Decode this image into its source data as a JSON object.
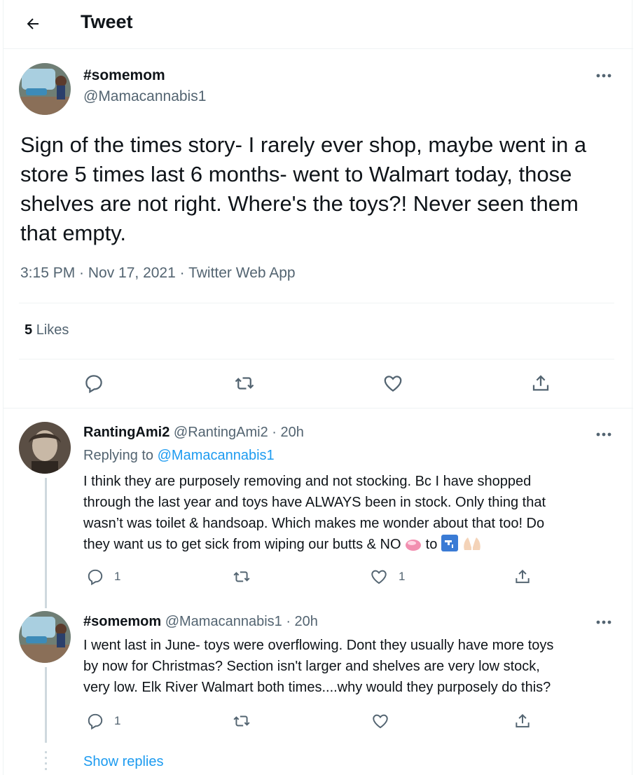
{
  "header": {
    "title": "Tweet",
    "back_icon": "arrow-left-icon"
  },
  "main_tweet": {
    "display_name": "#somemom",
    "handle": "@Mamacannabis1",
    "text": "Sign of the times story- I rarely ever shop, maybe went in a store 5 times last 6 months- went to Walmart today, those shelves are not right. Where's the toys?! Never seen them that empty.",
    "timestamp": "3:15 PM · Nov 17, 2021 · Twitter Web App",
    "likes_count": "5",
    "likes_label": "Likes"
  },
  "replies": [
    {
      "display_name": "RantingAmi2",
      "handle_time": "@RantingAmi2 · 20h",
      "replying_prefix": "Replying to",
      "replying_to": "@Mamacannabis1",
      "text_lines": [
        "I think they are purposely removing and not stocking. Bc I have shopped",
        "through the last year and toys have ALWAYS been in stock. Only thing that",
        "wasn’t was toilet & handsoap. Which makes me wonder about that too! Do",
        "they want us to get sick from wiping our butts & NO"
      ],
      "text_tail": "to",
      "reply_count": "1",
      "like_count": "1"
    },
    {
      "display_name": "#somemom",
      "handle_time": "@Mamacannabis1 · 20h",
      "text_lines": [
        "I went last in June- toys were overflowing. Dont they usually have more toys",
        "by now for Christmas? Section isn't larger and shelves are very low stock,",
        "very low. Elk River Walmart both times....why would they purposely do this?"
      ],
      "reply_count": "1"
    }
  ],
  "show_replies": "Show replies",
  "colors": {
    "accent": "#1d9bf0",
    "text": "#0f1419",
    "muted": "#536471",
    "border": "#eff3f4"
  }
}
